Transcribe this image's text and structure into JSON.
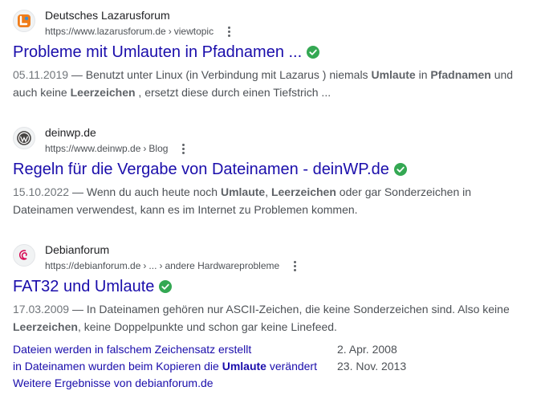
{
  "colors": {
    "link": "#1a0dab",
    "text": "#4d5156",
    "verified": "#34a853"
  },
  "results": [
    {
      "site_name": "Deutsches Lazarusforum",
      "url_base": "https://www.lazarusforum.de",
      "url_path": "viewtopic",
      "favicon": "lazarus-logo-icon",
      "title": "Probleme mit Umlauten in Pfadnamen ...",
      "date": "05.11.2019",
      "snippet": [
        "— Benutzt unter Linux (in Verbindung mit Lazarus ) niemals ",
        "Umlaute",
        " in ",
        "Pfadnamen",
        " und auch keine ",
        "Leerzeichen",
        " , ersetzt diese durch einen Tiefstrich ..."
      ]
    },
    {
      "site_name": "deinwp.de",
      "url_base": "https://www.deinwp.de",
      "url_path": "Blog",
      "favicon": "wordpress-icon",
      "title": "Regeln für die Vergabe von Dateinamen - deinWP.de",
      "date": "15.10.2022",
      "snippet": [
        "— Wenn du auch heute noch ",
        "Umlaute",
        ", ",
        "Leerzeichen",
        " oder gar Sonderzeichen in Dateinamen verwendest, kann es im Internet zu Problemen kommen."
      ]
    },
    {
      "site_name": "Debianforum",
      "url_base": "https://debianforum.de",
      "url_path1": "...",
      "url_path2": "andere Hardwareprobleme",
      "favicon": "debian-swirl-icon",
      "title": "FAT32 und Umlaute",
      "date": "17.03.2009",
      "snippet": [
        "— In Dateinamen gehören nur ASCII-Zeichen, die keine Sonderzeichen sind. Also keine ",
        "Leerzeichen",
        ", keine Doppelpunkte und schon gar keine Linefeed."
      ],
      "sitelinks": [
        {
          "text": [
            "Dateien werden in falschem Zeichensatz erstellt"
          ],
          "date": "2. Apr. 2008"
        },
        {
          "text": [
            "in Dateinamen wurden beim Kopieren die ",
            "Umlaute",
            " verändert"
          ],
          "date": "23. Nov. 2013"
        }
      ],
      "more_results": "Weitere Ergebnisse von debianforum.de"
    }
  ]
}
